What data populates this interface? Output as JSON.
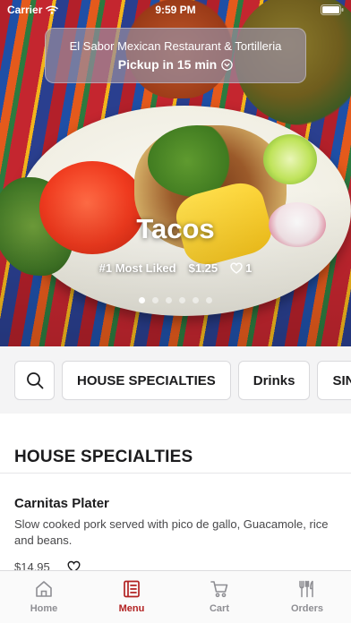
{
  "status_bar": {
    "carrier": "Carrier",
    "time": "9:59 PM"
  },
  "restaurant": {
    "name": "El Sabor Mexican Restaurant & Tortilleria",
    "pickup": "Pickup in 15 min"
  },
  "featured": {
    "title": "Tacos",
    "rank": "#1 Most Liked",
    "price": "$1.25",
    "likes": "1",
    "carousel_pages": 6,
    "carousel_active_index": 0
  },
  "categories": [
    "HOUSE SPECIALTIES",
    "Drinks",
    "SINGLE ITEMS"
  ],
  "section": {
    "title": "HOUSE SPECIALTIES"
  },
  "items": [
    {
      "name": "Carnitas Plater",
      "description": "Slow cooked pork served with pico de gallo, Guacamole, rice and beans.",
      "price": "$14.95"
    }
  ],
  "tabs": [
    {
      "label": "Home",
      "icon": "home-icon",
      "active": false
    },
    {
      "label": "Menu",
      "icon": "menu-icon",
      "active": true
    },
    {
      "label": "Cart",
      "icon": "cart-icon",
      "active": false
    },
    {
      "label": "Orders",
      "icon": "orders-icon",
      "active": false
    }
  ],
  "colors": {
    "accent": "#b22222",
    "inactive": "#8e8e93"
  }
}
